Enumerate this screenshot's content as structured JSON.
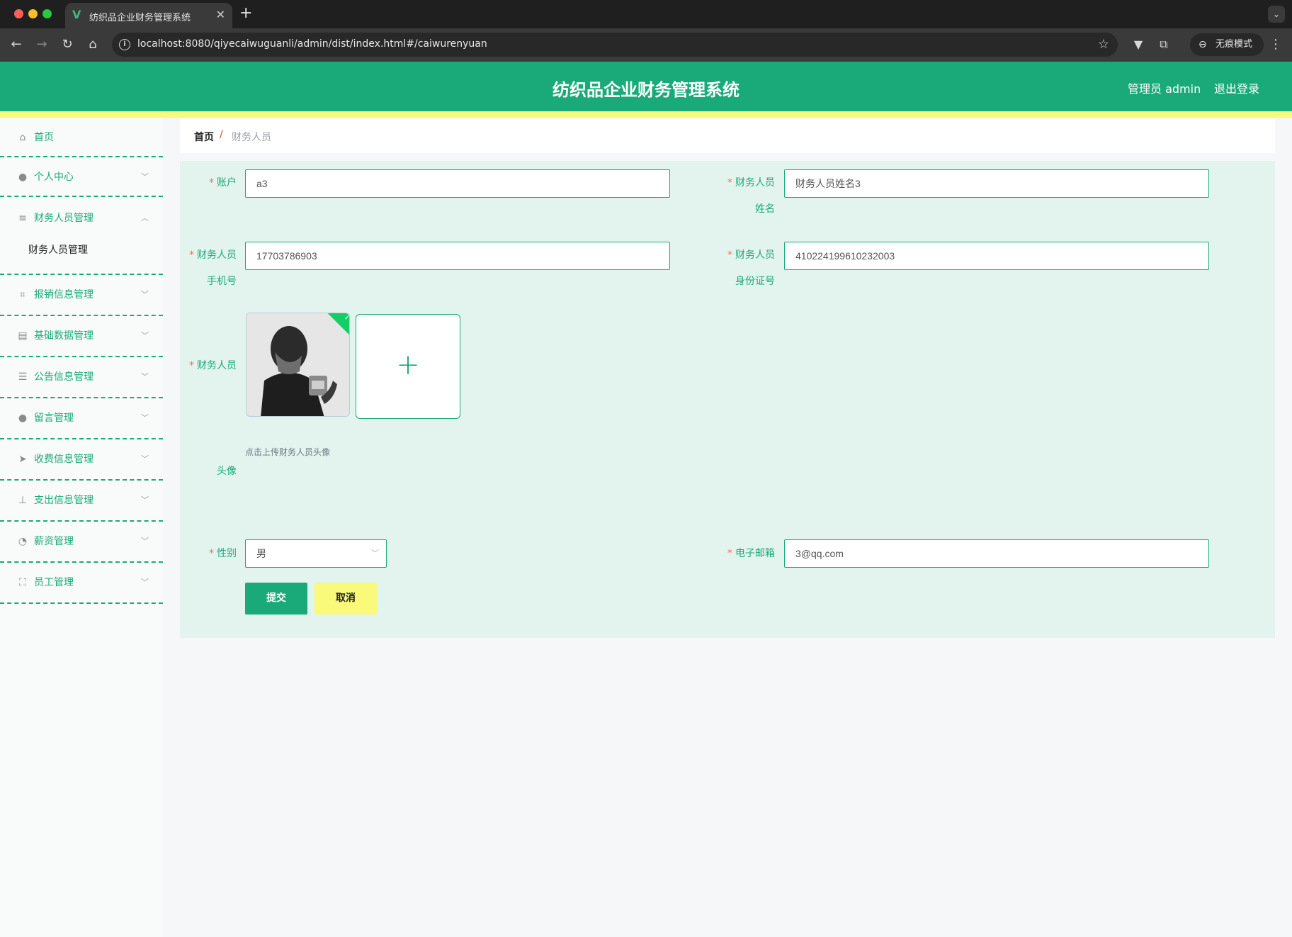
{
  "browser": {
    "tab_title": "纺织品企业财务管理系统",
    "url": "localhost:8080/qiyecaiwuguanli/admin/dist/index.html#/caiwurenyuan",
    "incognito_label": "无痕模式"
  },
  "header": {
    "title": "纺织品企业财务管理系统",
    "user": "管理员 admin",
    "logout": "退出登录"
  },
  "sidebar": {
    "items": [
      {
        "label": "首页",
        "icon": "home-icon"
      },
      {
        "label": "个人中心",
        "icon": "user-icon"
      },
      {
        "label": "财务人员管理",
        "icon": "sliders-icon",
        "expanded": true,
        "sub": [
          "财务人员管理"
        ]
      },
      {
        "label": "报销信息管理",
        "icon": "crop-icon"
      },
      {
        "label": "基础数据管理",
        "icon": "clipboard-icon"
      },
      {
        "label": "公告信息管理",
        "icon": "list-icon"
      },
      {
        "label": "留言管理",
        "icon": "user-icon"
      },
      {
        "label": "收费信息管理",
        "icon": "send-icon"
      },
      {
        "label": "支出信息管理",
        "icon": "stamp-icon"
      },
      {
        "label": "薪资管理",
        "icon": "compass-icon"
      },
      {
        "label": "员工管理",
        "icon": "fullscreen-icon"
      }
    ]
  },
  "breadcrumb": {
    "home": "首页",
    "separator": "/",
    "current": "财务人员"
  },
  "form": {
    "account": {
      "label": "账户",
      "value": "a3"
    },
    "name": {
      "label_line1": "财务人员",
      "label_line2": "姓名",
      "value": "财务人员姓名3"
    },
    "phone": {
      "label_line1": "财务人员",
      "label_line2": "手机号",
      "value": "17703786903"
    },
    "idcard": {
      "label_line1": "财务人员",
      "label_line2": "身份证号",
      "value": "410224199610232003"
    },
    "avatar": {
      "label_line1": "财务人员",
      "label_line2": "头像",
      "tip": "点击上传财务人员头像",
      "add_symbol": "+"
    },
    "gender": {
      "label": "性别",
      "value": "男"
    },
    "email": {
      "label": "电子邮箱",
      "value": "3@qq.com"
    },
    "required_mark": "*",
    "submit": "提交",
    "cancel": "取消"
  },
  "colors": {
    "primary": "#1aaa7a",
    "accent_yellow": "#f9f97a",
    "required": "#f56c6c"
  }
}
